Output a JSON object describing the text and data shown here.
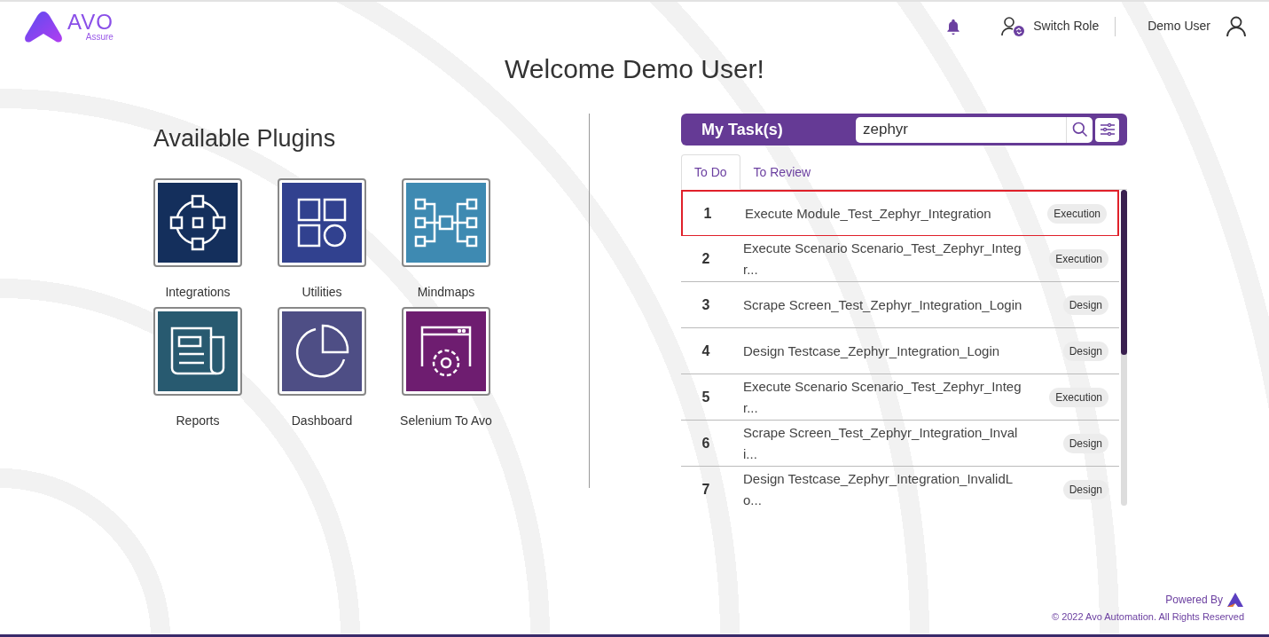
{
  "header": {
    "logo": {
      "name": "AVO",
      "subtitle": "Assure"
    },
    "switch_role": "Switch Role",
    "user_name": "Demo User"
  },
  "welcome": "Welcome Demo User!",
  "plugins": {
    "title": "Available Plugins",
    "items": [
      {
        "label": "Integrations",
        "kind": "integrations",
        "color": "#142f5c"
      },
      {
        "label": "Utilities",
        "kind": "utilities",
        "color": "#31418f"
      },
      {
        "label": "Mindmaps",
        "kind": "mindmaps",
        "color": "#3e8ab2"
      },
      {
        "label": "Reports",
        "kind": "reports",
        "color": "#285a70"
      },
      {
        "label": "Dashboard",
        "kind": "dashboard",
        "color": "#4e4e85"
      },
      {
        "label": "Selenium To Avo",
        "kind": "selenium",
        "color": "#6e1d70"
      }
    ]
  },
  "tasks": {
    "title": "My Task(s)",
    "search": {
      "value": "zephyr"
    },
    "tabs": [
      {
        "label": "To Do",
        "selected": true
      },
      {
        "label": "To Review",
        "selected": false
      }
    ],
    "rows": [
      {
        "number": "1",
        "name": "Execute Module_Test_Zephyr_Integration",
        "type": "Execution",
        "highlighted": true
      },
      {
        "number": "2",
        "name": "Execute Scenario Scenario_Test_Zephyr_Integr...",
        "type": "Execution",
        "highlighted": false
      },
      {
        "number": "3",
        "name": "Scrape Screen_Test_Zephyr_Integration_Login",
        "type": "Design",
        "highlighted": false
      },
      {
        "number": "4",
        "name": "Design Testcase_Zephyr_Integration_Login",
        "type": "Design",
        "highlighted": false
      },
      {
        "number": "5",
        "name": "Execute Scenario Scenario_Test_Zephyr_Integr...",
        "type": "Execution",
        "highlighted": false
      },
      {
        "number": "6",
        "name": "Scrape Screen_Test_Zephyr_Integration_Invali...",
        "type": "Design",
        "highlighted": false
      },
      {
        "number": "7",
        "name": "Design Testcase_Zephyr_Integration_InvalidLo...",
        "type": "Design",
        "highlighted": false
      }
    ]
  },
  "footer": {
    "powered_by": "Powered By",
    "copyright": "© 2022 Avo Automation. All Rights Reserved"
  }
}
